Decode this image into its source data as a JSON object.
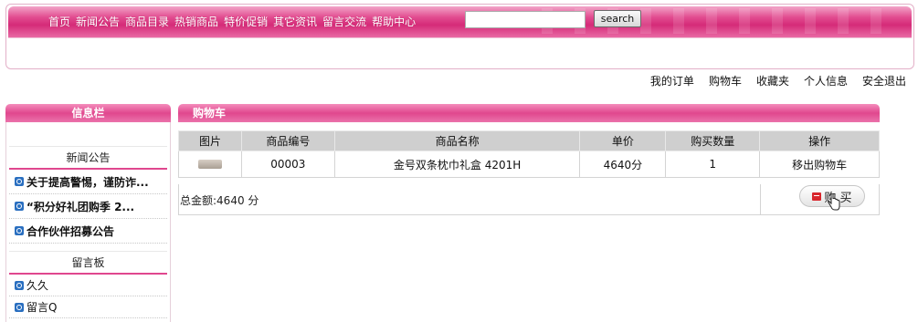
{
  "nav": {
    "items": [
      "首页",
      "新闻公告",
      "商品目录",
      "热销商品",
      "特价促销",
      "其它资讯",
      "留言交流",
      "帮助中心"
    ],
    "search_placeholder": "",
    "search_value": "",
    "search_button": "search"
  },
  "user_links": [
    "我的订单",
    "购物车",
    "收藏夹",
    "个人信息",
    "安全退出"
  ],
  "sidebar": {
    "title": "信息栏",
    "news_title": "新闻公告",
    "news": [
      "关于提高警惕，谨防诈...",
      "“积分好礼团购季  2...",
      "合作伙伴招募公告"
    ],
    "board_title": "留言板",
    "messages": [
      "久久",
      "留言Q"
    ]
  },
  "cart": {
    "title": "购物车",
    "columns": [
      "图片",
      "商品编号",
      "商品名称",
      "单价",
      "购买数量",
      "操作"
    ],
    "rows": [
      {
        "code": "00003",
        "name": "金号双条枕巾礼盒 4201H",
        "price": "4640分",
        "qty": "1",
        "action": "移出购物车"
      }
    ],
    "total": "总金额:4640 分",
    "buy_label": "购 买"
  },
  "colors": {
    "brand_pink": "#e0478e",
    "header_gray": "#cfcfcf"
  }
}
